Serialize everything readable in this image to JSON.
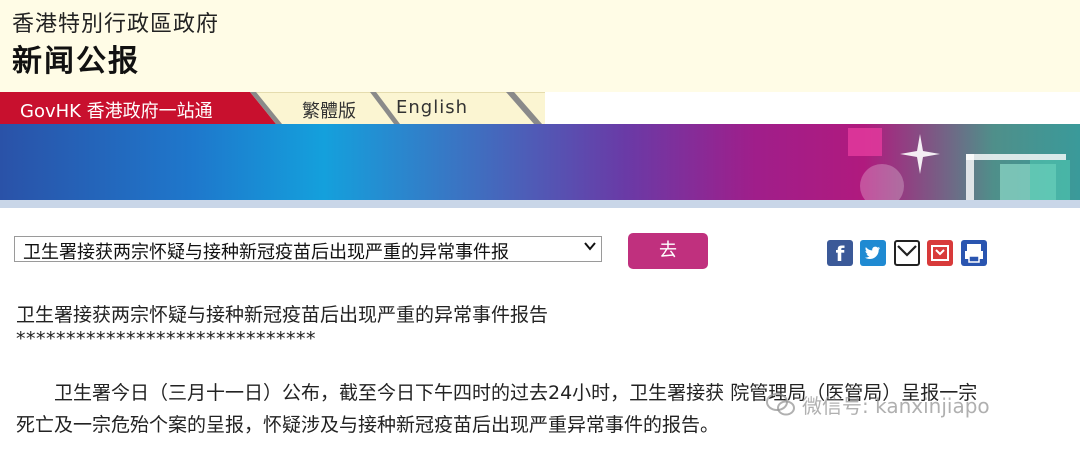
{
  "header": {
    "gov_name": "香港特別行政區政府",
    "press_title": "新闻公报"
  },
  "nav": {
    "govhk": "GovHK 香港政府一站通",
    "traditional": "繁體版",
    "english": "English"
  },
  "toolbar": {
    "selected_release": "卫生署接获两宗怀疑与接种新冠疫苗后出现严重的异常事件报",
    "go_label": "去",
    "share_icons": [
      "facebook-icon",
      "twitter-icon",
      "mail-icon",
      "bookmark-icon",
      "print-icon"
    ]
  },
  "article": {
    "title": "卫生署接获两宗怀疑与接种新冠疫苗后出现严重的异常事件报告",
    "separator": "******************************",
    "para1": "卫生署今日（三月十一日）公布，截至今日下午四时的过去24小时，卫生署接获   院管理局（医管局）呈报一宗",
    "para2": "死亡及一宗危殆个案的呈报，怀疑涉及与接种新冠疫苗后出现严重异常事件的报告。"
  },
  "watermark": {
    "text": "微信号: kanxinjiapo"
  },
  "colors": {
    "accent": "#c0307e",
    "govhk_tab": "#c8102e",
    "header_bg": "#fffce6"
  }
}
